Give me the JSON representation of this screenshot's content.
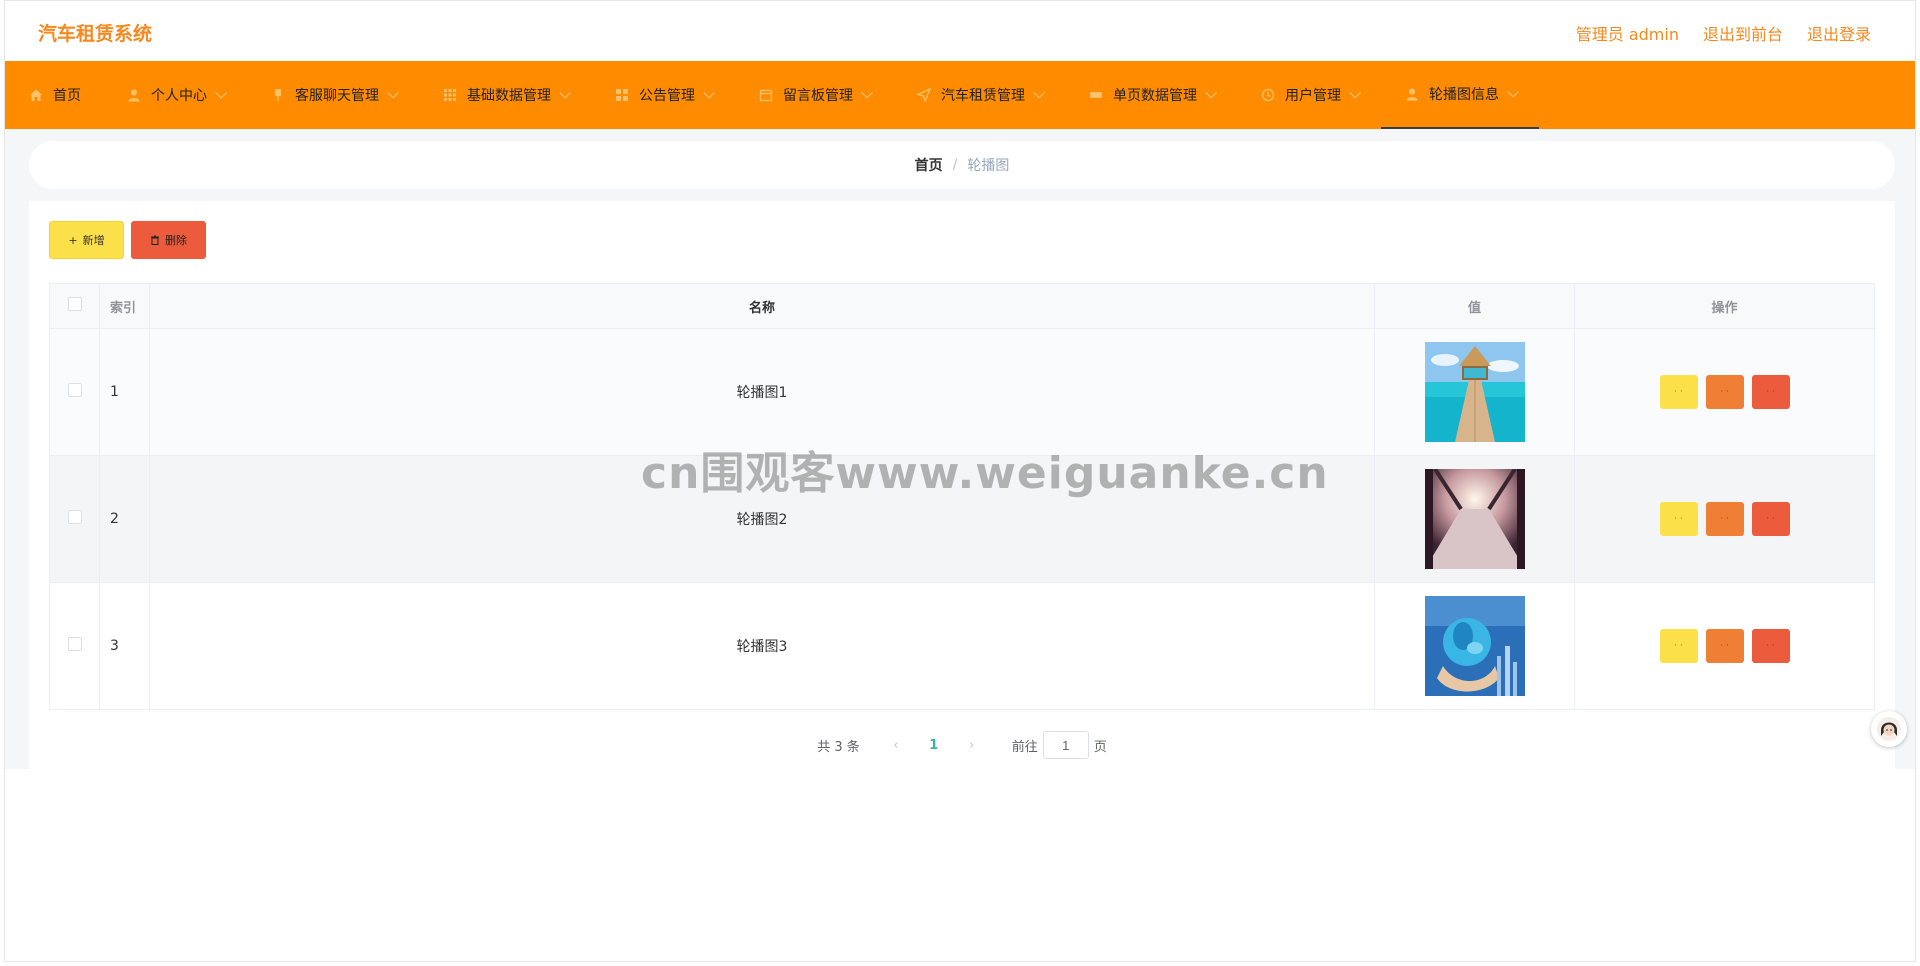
{
  "app": {
    "title": "汽车租赁系统",
    "admin_label": "管理员 admin",
    "to_front_label": "退出到前台",
    "logout_label": "退出登录"
  },
  "nav": {
    "items": [
      {
        "label": "首页",
        "icon": "home-icon"
      },
      {
        "label": "个人中心",
        "icon": "user-icon"
      },
      {
        "label": "客服聊天管理",
        "icon": "pin-icon"
      },
      {
        "label": "基础数据管理",
        "icon": "grid-icon"
      },
      {
        "label": "公告管理",
        "icon": "apps-icon"
      },
      {
        "label": "留言板管理",
        "icon": "calendar-icon"
      },
      {
        "label": "汽车租赁管理",
        "icon": "send-icon"
      },
      {
        "label": "单页数据管理",
        "icon": "gamepad-icon"
      },
      {
        "label": "用户管理",
        "icon": "clock-icon"
      },
      {
        "label": "轮播图信息",
        "icon": "user-icon",
        "active": true
      }
    ]
  },
  "breadcrumb": {
    "home": "首页",
    "separator": "/",
    "current": "轮播图"
  },
  "toolbar": {
    "add_label": "新增",
    "delete_label": "删除"
  },
  "table": {
    "columns": [
      "索引",
      "名称",
      "值",
      "操作"
    ],
    "rows": [
      {
        "index": "1",
        "name": "轮播图1",
        "image": "beach-gazebo-thumbnail"
      },
      {
        "index": "2",
        "name": "轮播图2",
        "image": "bridge-thumbnail"
      },
      {
        "index": "3",
        "name": "轮播图3",
        "image": "globe-hand-thumbnail"
      }
    ]
  },
  "pagination": {
    "total": "共 3 条",
    "current_page": "1",
    "goto_label": "前往",
    "goto_value": "1",
    "page_suffix": "页"
  },
  "watermark": "cn围观客www.weiguanke.cn",
  "colors": {
    "brand": "#f5881f",
    "nav_bg": "#ff8c00",
    "yellow": "#fce04a",
    "orange": "#ef7f34",
    "red": "#eb5b3c",
    "page_active": "#3bb39a"
  }
}
